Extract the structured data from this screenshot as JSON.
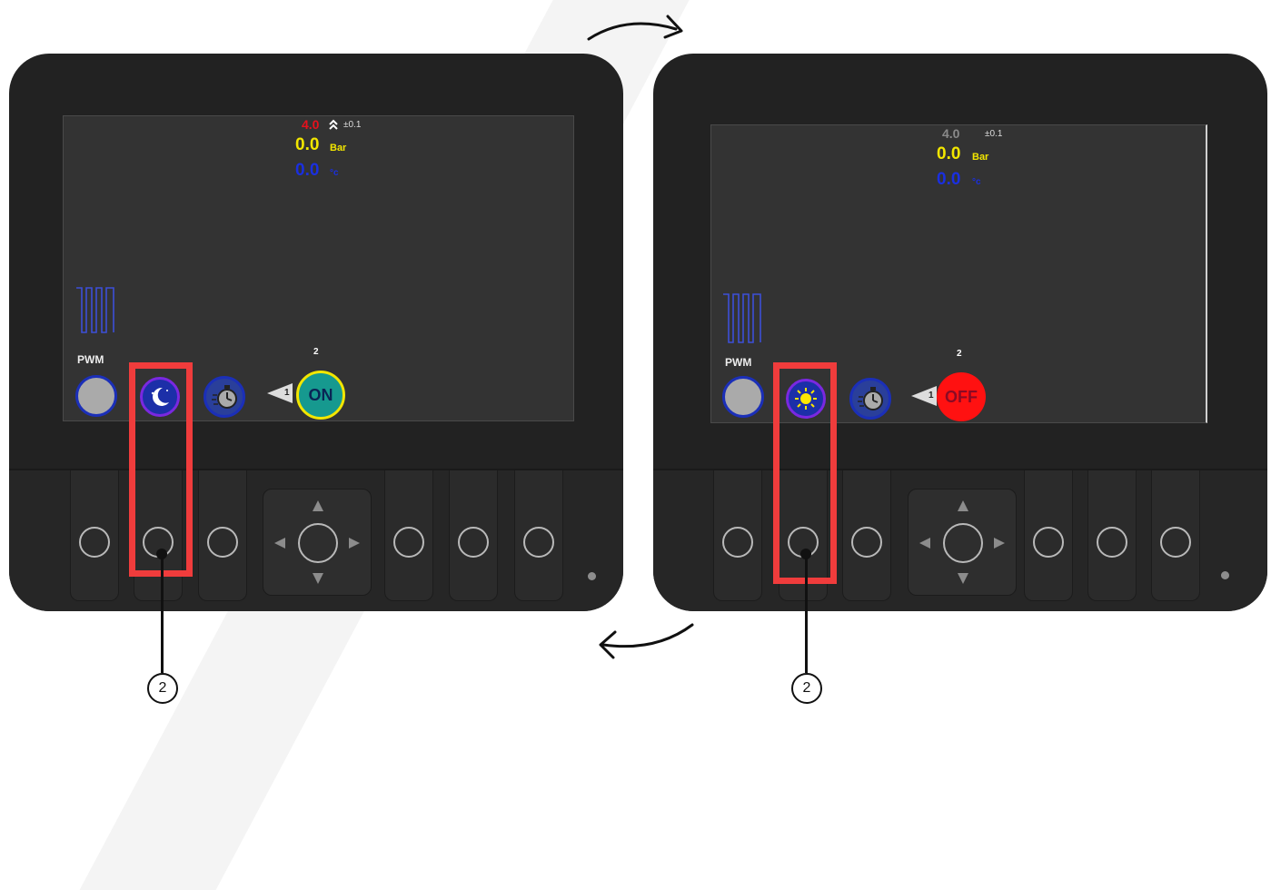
{
  "left_device": {
    "setpoint": "4.0",
    "tolerance": "±0.1",
    "pressure_value": "0.0",
    "pressure_unit": "Bar",
    "temperature_value": "0.0",
    "temperature_unit": "°c",
    "pwm_label": "PWM",
    "mode_icon": "moon-icon",
    "pump_number": "2",
    "arrow_number": "1",
    "state_label": "ON",
    "state_color": "#16998f"
  },
  "right_device": {
    "setpoint": "4.0",
    "tolerance": "±0.1",
    "pressure_value": "0.0",
    "pressure_unit": "Bar",
    "temperature_value": "0.0",
    "temperature_unit": "°c",
    "pwm_label": "PWM",
    "mode_icon": "sun-icon",
    "pump_number": "2",
    "arrow_number": "1",
    "state_label": "OFF",
    "state_color": "#ff1111"
  },
  "callouts": {
    "left": "2",
    "right": "2"
  },
  "colors": {
    "highlight": "#f03c3c",
    "setpoint_active": "#e8101c",
    "setpoint_inactive": "#8a8a8a",
    "pressure": "#f2e600",
    "temperature": "#1a2fe0",
    "button_ring": "#7a28e0"
  }
}
